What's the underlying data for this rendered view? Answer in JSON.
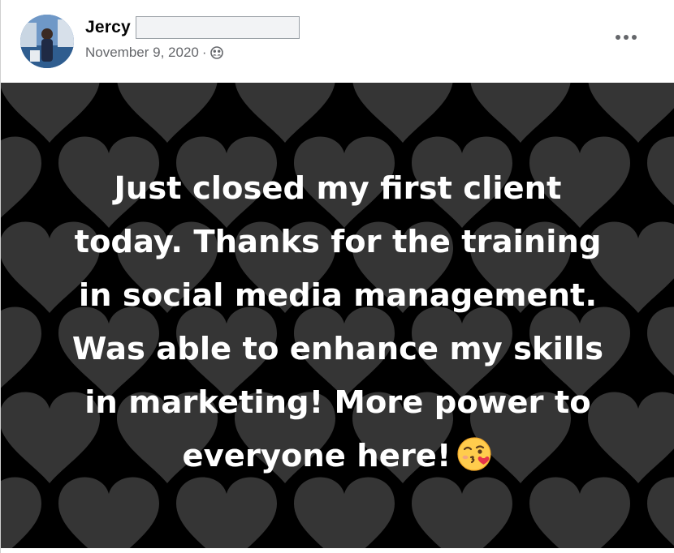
{
  "post": {
    "author": {
      "name": "Jercy"
    },
    "timestamp": "November 9, 2020",
    "separator": "·",
    "audience_icon": "friends-icon",
    "more_icon": "more-options-icon",
    "background_theme": "hearts",
    "text_lines": [
      "Just closed my first client",
      "today. Thanks for the training",
      "in social media management.",
      "Was able to enhance my skills",
      "in marketing! More power to",
      "everyone here!"
    ],
    "emoji": "face-blowing-a-kiss-icon"
  },
  "colors": {
    "background": "#000000",
    "hearts": "#3a3a3a",
    "text": "#ffffff",
    "meta": "#65676b",
    "name": "#050505"
  }
}
